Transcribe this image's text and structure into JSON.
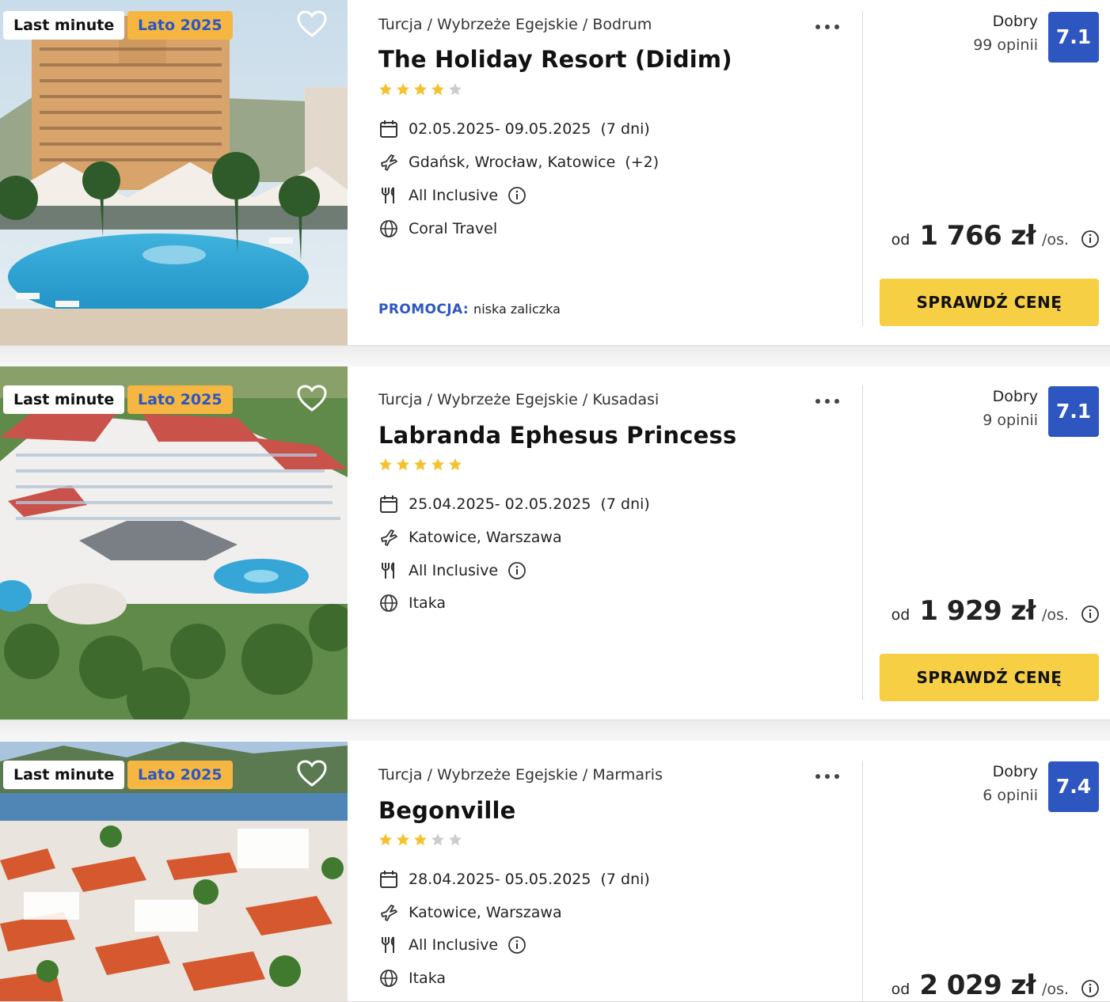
{
  "colors": {
    "accent_blue": "#2d56c0",
    "cta_yellow": "#f6cf45",
    "season_badge": "#f5b742",
    "star_gold": "#f5c12e",
    "star_gray": "#cccccc"
  },
  "common": {
    "badge_last_minute": "Last minute",
    "badge_season": "Lato 2025",
    "price_prefix": "od",
    "price_suffix": "/os.",
    "cta_label": "SPRAWDŹ CENĘ",
    "rating_word": "Dobry",
    "promo_label": "PROMOCJA:"
  },
  "offers": [
    {
      "breadcrumb": "Turcja / Wybrzeże Egejskie / Bodrum",
      "title": "The Holiday Resort (Didim)",
      "stars": 4,
      "dates": "02.05.2025- 09.05.2025",
      "duration": "(7 dni)",
      "departures": "Gdańsk, Wrocław, Katowice",
      "departures_extra": "(+2)",
      "board": "All Inclusive",
      "operator": "Coral Travel",
      "promo_text": "niska zaliczka",
      "rating_count": "99 opinii",
      "score": "7.1",
      "price": "1 766 zł"
    },
    {
      "breadcrumb": "Turcja / Wybrzeże Egejskie / Kusadasi",
      "title": "Labranda Ephesus Princess",
      "stars": 5,
      "dates": "25.04.2025- 02.05.2025",
      "duration": "(7 dni)",
      "departures": "Katowice, Warszawa",
      "departures_extra": "",
      "board": "All Inclusive",
      "operator": "Itaka",
      "promo_text": "",
      "rating_count": "9 opinii",
      "score": "7.1",
      "price": "1 929 zł"
    },
    {
      "breadcrumb": "Turcja / Wybrzeże Egejskie / Marmaris",
      "title": "Begonville",
      "stars": 3,
      "dates": "28.04.2025- 05.05.2025",
      "duration": "(7 dni)",
      "departures": "Katowice, Warszawa",
      "departures_extra": "",
      "board": "All Inclusive",
      "operator": "Itaka",
      "promo_text": "",
      "rating_count": "6 opinii",
      "score": "7.4",
      "price": "2 029 zł"
    }
  ]
}
